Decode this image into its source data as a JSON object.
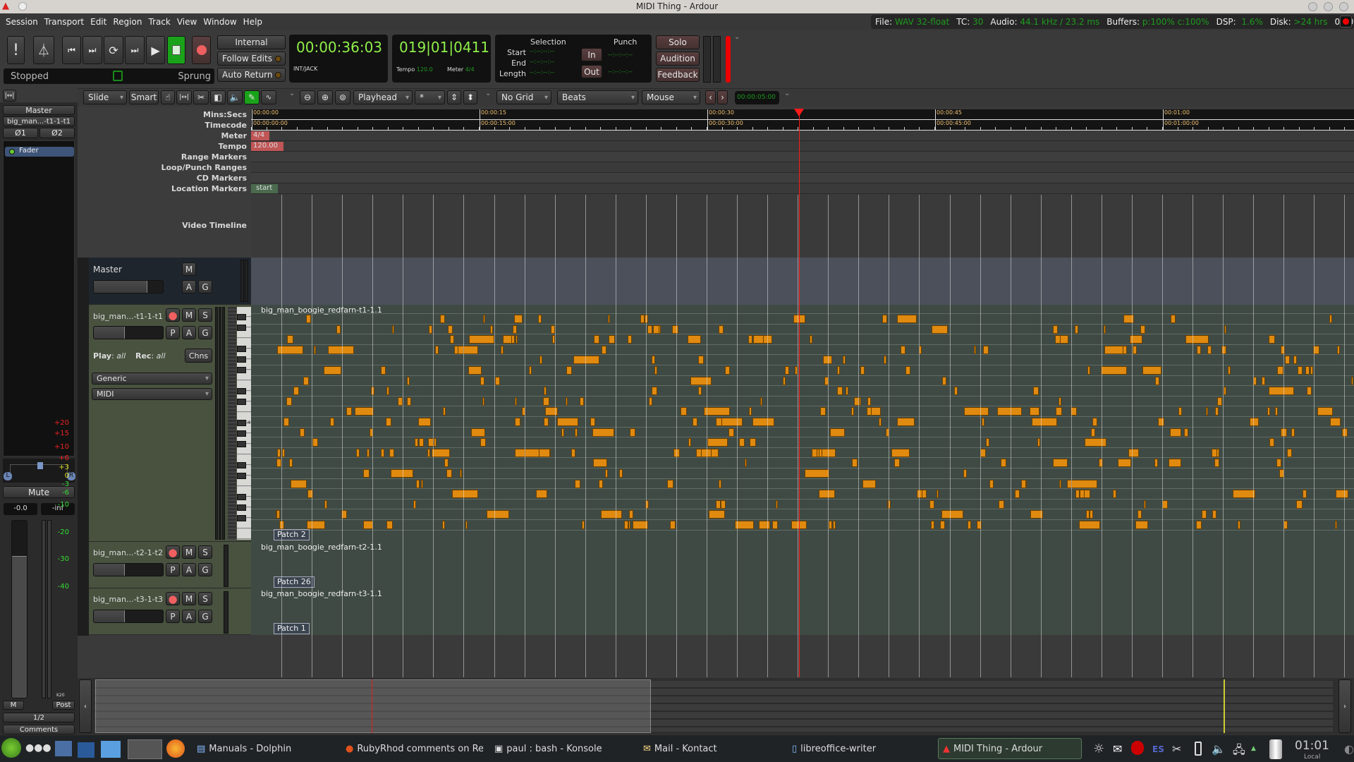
{
  "window": {
    "title": "MIDI Thing - Ardour"
  },
  "menu": [
    "Session",
    "Transport",
    "Edit",
    "Region",
    "Track",
    "View",
    "Window",
    "Help"
  ],
  "status": {
    "file_label": "File:",
    "file": "WAV 32-float",
    "tc_label": "TC:",
    "tc": "30",
    "audio_label": "Audio:",
    "audio": "44.1 kHz / 23.2 ms",
    "buffers_label": "Buffers:",
    "buffers": "p:100% c:100%",
    "dsp_label": "DSP:",
    "dsp": "1.6%",
    "disk_label": "Disk:",
    "disk": ">24 hrs",
    "time": "01:01"
  },
  "transport": {
    "state": "Stopped",
    "sprung": "Sprung",
    "internal": "Internal",
    "follow_edits": "Follow Edits",
    "auto_return": "Auto Return",
    "primary_clock": "00:00:36:03",
    "clock_source": "INT/JACK",
    "bbt_clock": "019|01|0411",
    "tempo_label": "Tempo",
    "tempo": "120.0",
    "meter_label": "Meter",
    "meter": "4/4",
    "selection": "Selection",
    "punch": "Punch",
    "start": "Start",
    "end": "End",
    "length": "Length",
    "empty_time": "--:--:--:--",
    "in": "In",
    "out": "Out",
    "solo": "Solo",
    "audition": "Audition",
    "feedback": "Feedback"
  },
  "toolbar": {
    "edit_mode": "Slide",
    "smart": "Smart",
    "edit_point": "Playhead",
    "ripple": "*",
    "grid": "No Grid",
    "grid_unit": "Beats",
    "snap": "Mouse",
    "nudge_clock": "00:00:05:00"
  },
  "rulers": {
    "labels": [
      "Mins:Secs",
      "Timecode",
      "Meter",
      "Tempo",
      "Range Markers",
      "Loop/Punch Ranges",
      "CD Markers",
      "Location Markers"
    ],
    "video": "Video Timeline",
    "minsec_ticks": [
      "00:00:00",
      "00:00:15",
      "00:00:30",
      "00:00:45",
      "00:01:00"
    ],
    "tc_ticks": [
      "00:00:00:00",
      "00:00:15:00",
      "00:00:30:00",
      "00:00:45:00",
      "00:01:00:00"
    ],
    "meter_marker": "4/4",
    "tempo_marker": "120.00",
    "location_marker": "start",
    "playhead_seconds": 36.1
  },
  "strip": {
    "master": "Master",
    "name": "big_man...-t1-1-t1",
    "phase1": "Ø1",
    "phase2": "Ø2",
    "processor": "Fader",
    "pan_l": "L",
    "pan_r": "R",
    "mute": "Mute",
    "gain": "-0.0",
    "peak": "-inf",
    "meter_type": "K20",
    "scale": [
      "+20",
      "+15",
      "+10",
      "+6",
      "+3",
      "0",
      "-3",
      "-6",
      "-10",
      "-20",
      "-30",
      "-40"
    ],
    "m": "M",
    "post": "Post",
    "io": "1/2",
    "comments": "Comments",
    "fader_level": 0.8
  },
  "tracks": {
    "master": {
      "name": "Master",
      "m": "M",
      "a": "A",
      "g": "G",
      "fader_level": 0.78
    },
    "t1": {
      "name": "big_man...-t1-1-t1",
      "m": "M",
      "s": "S",
      "p": "P",
      "a": "A",
      "g": "G",
      "play_label": "Play",
      "play": "all",
      "rec_label": "Rec",
      "rec": "all",
      "chns": "Chns",
      "instrument": "Generic",
      "mode": "MIDI",
      "region": "big_man_boogie_redfarn-t1-1.1",
      "patch": "Patch 2",
      "c4": "C4",
      "fader_level": 0.45
    },
    "t2": {
      "name": "big_man...-t2-1-t2",
      "m": "M",
      "s": "S",
      "p": "P",
      "a": "A",
      "g": "G",
      "region": "big_man_boogie_redfarn-t2-1.1",
      "patch": "Patch 26",
      "fader_level": 0.45
    },
    "t3": {
      "name": "big_man...-t3-1-t3",
      "m": "M",
      "s": "S",
      "p": "P",
      "a": "A",
      "g": "G",
      "region": "big_man_boogie_redfarn-t3-1.1",
      "patch": "Patch 1",
      "fader_level": 0.45
    }
  },
  "taskbar": {
    "windows": [
      "Manuals - Dolphin",
      "RubyRhod comments on Re",
      "paul : bash - Konsole",
      "Mail - Kontact",
      "libreoffice-writer",
      "MIDI Thing - Ardour"
    ],
    "tray_lang": "ES",
    "clock": "01:01",
    "clock_sub": "Local"
  },
  "colors": {
    "note": "#e08a10",
    "clock_green": "#8ff04a",
    "status_green": "#1f9a1f",
    "playhead": "#ff1a1a",
    "track_bg": "#48523f"
  }
}
